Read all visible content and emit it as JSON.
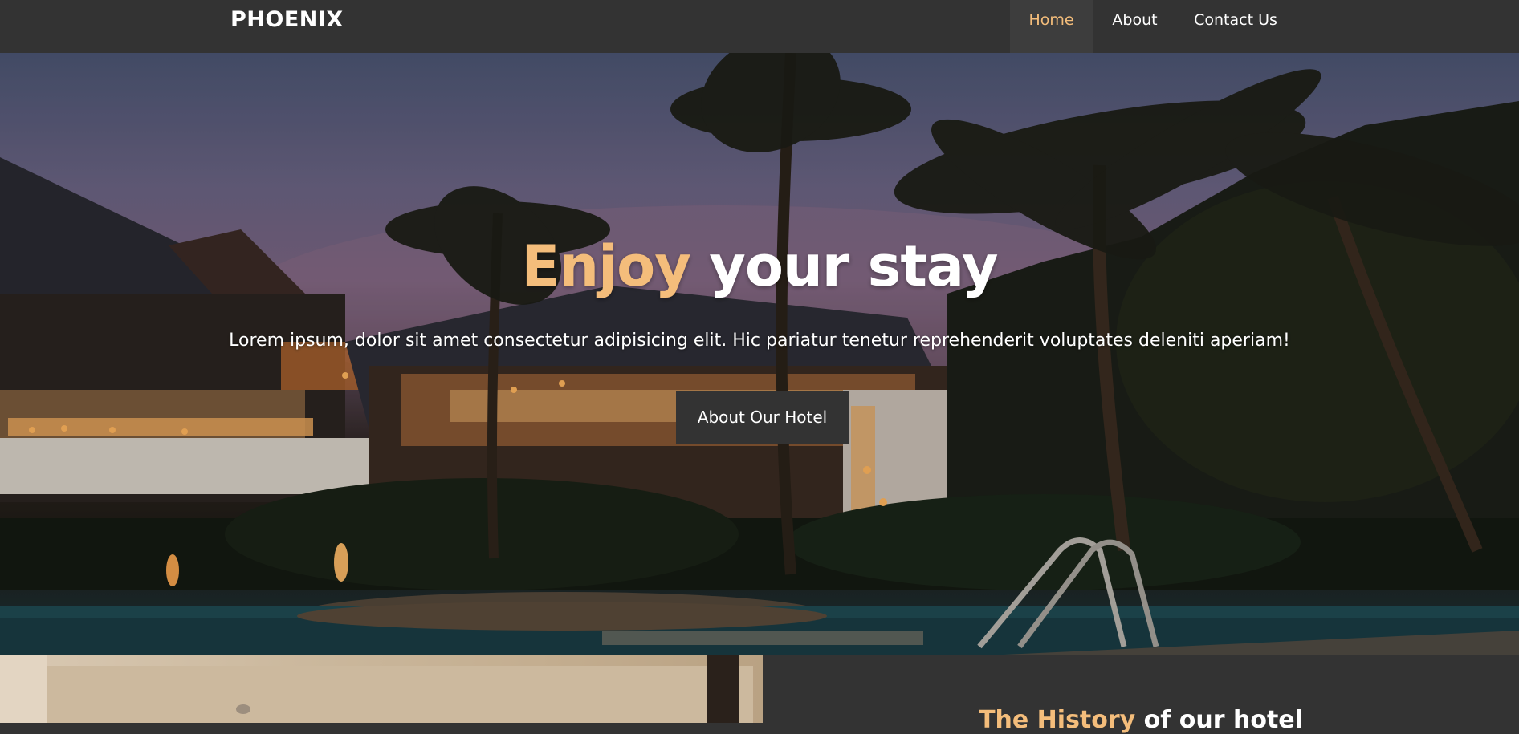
{
  "navbar": {
    "brand": "PHOENIX",
    "items": [
      {
        "label": "Home",
        "active": true
      },
      {
        "label": "About",
        "active": false
      },
      {
        "label": "Contact Us",
        "active": false
      }
    ]
  },
  "hero": {
    "title_accent": "Enjoy",
    "title_rest": " your stay",
    "subtitle": "Lorem ipsum, dolor sit amet consectetur adipisicing elit. Hic pariatur tenetur reprehenderit voluptates deleniti aperiam!",
    "button_label": "About Our Hotel"
  },
  "history": {
    "title_accent": "The History",
    "title_rest": " of our hotel"
  },
  "colors": {
    "accent": "#f4bd7b",
    "dark": "#333333",
    "text": "#ffffff"
  }
}
